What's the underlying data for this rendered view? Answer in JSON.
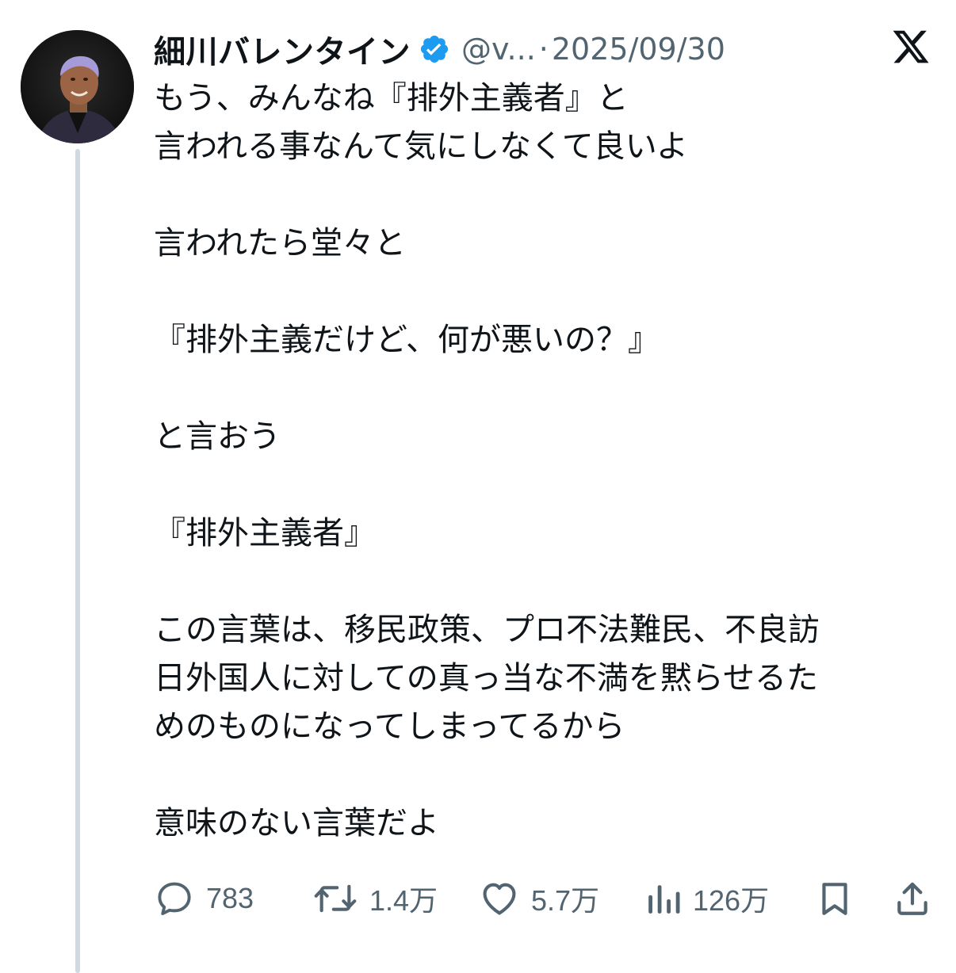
{
  "tweet": {
    "author": {
      "name": "細川バレンタイン",
      "verified": true,
      "handle": "@v...",
      "separator": "·",
      "date": "2025/09/30"
    },
    "platform_icon": "x-logo-icon",
    "body": [
      "もう、みんなね『排外主義者』と",
      "言われる事なんて気にしなくて良いよ",
      "",
      "言われたら堂々と",
      "",
      "『排外主義だけど、何が悪いの？』",
      "",
      "と言おう",
      "",
      "『排外主義者』",
      "",
      "この言葉は、移民政策、プロ不法難民、不良訪",
      "日外国人に対しての真っ当な不満を黙らせるた",
      "めのものになってしまってるから",
      "",
      "意味のない言葉だよ"
    ],
    "actions": {
      "replies": "783",
      "reposts": "1.4万",
      "likes": "5.7万",
      "views": "126万"
    }
  },
  "colors": {
    "text": "#0f1419",
    "muted": "#536471",
    "verified_blue": "#1d9bf0",
    "thread_line": "#cfd9de",
    "hair": "#a59bd8"
  }
}
